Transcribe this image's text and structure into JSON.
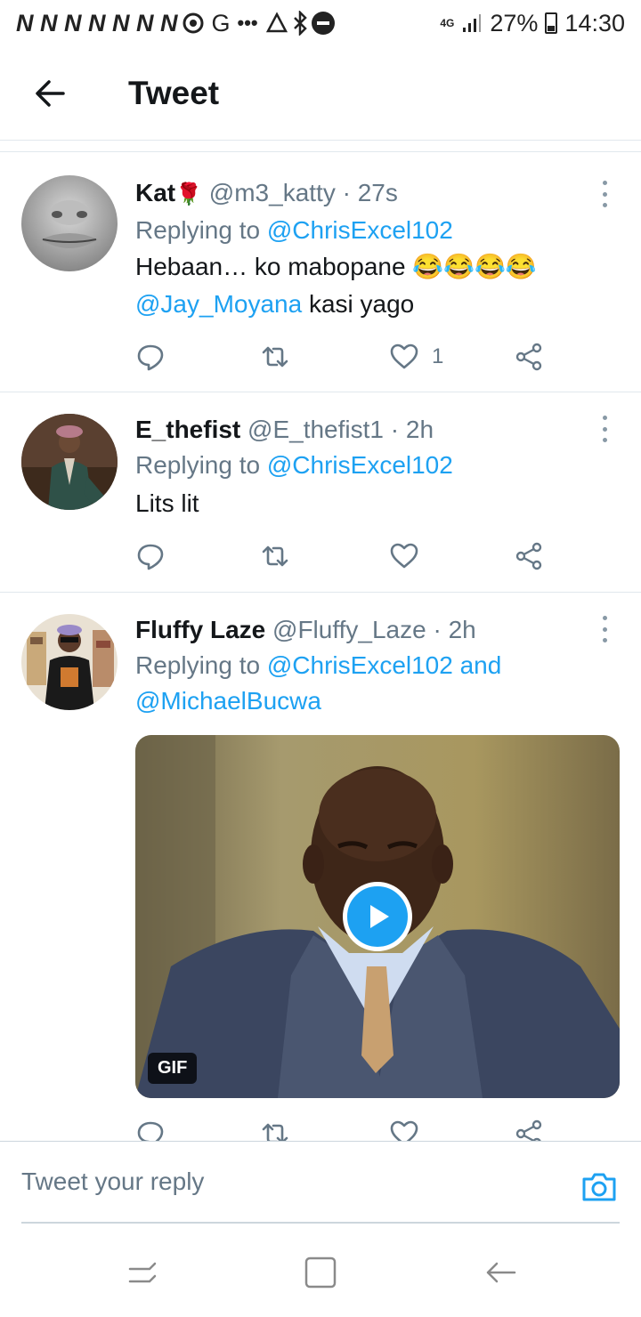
{
  "status_bar": {
    "notif_letters": "N N N N N N N",
    "g_label": "G",
    "dots": "•••",
    "network": "4G",
    "battery": "27%",
    "time": "14:30"
  },
  "header": {
    "title": "Tweet"
  },
  "tweets": [
    {
      "name": "Kat",
      "emoji": "🌹",
      "handle": "@m3_katty",
      "time": "· 27s",
      "replying_prefix": "Replying to ",
      "replying_to": "@ChrisExcel102",
      "text_line1": "Hebaan… ko mabopane 😂😂😂😂",
      "text_mention": "@Jay_Moyana",
      "text_line2_rest": " kasi yago",
      "like_count": "1"
    },
    {
      "name": "E_thefist",
      "handle": "@E_thefist1",
      "time": "· 2h",
      "replying_prefix": "Replying to ",
      "replying_to": "@ChrisExcel102",
      "text": "Lits lit",
      "like_count": ""
    },
    {
      "name": "Fluffy Laze",
      "handle": "@Fluffy_Laze",
      "time": "· 2h",
      "replying_prefix": "Replying to ",
      "replying_to": "@ChrisExcel102 and",
      "replying_to_2": "@MichaelBucwa",
      "media_badge": "GIF"
    }
  ],
  "composer": {
    "placeholder": "Tweet your reply"
  },
  "icons": {
    "back": "arrow-left-icon",
    "reply": "reply-icon",
    "retweet": "retweet-icon",
    "like": "heart-icon",
    "share": "share-icon",
    "more": "more-vertical-icon",
    "camera": "camera-icon",
    "play": "play-icon"
  },
  "colors": {
    "accent": "#1da1f2",
    "text": "#14171a",
    "secondary": "#657786",
    "divider": "#e1e8ed"
  }
}
